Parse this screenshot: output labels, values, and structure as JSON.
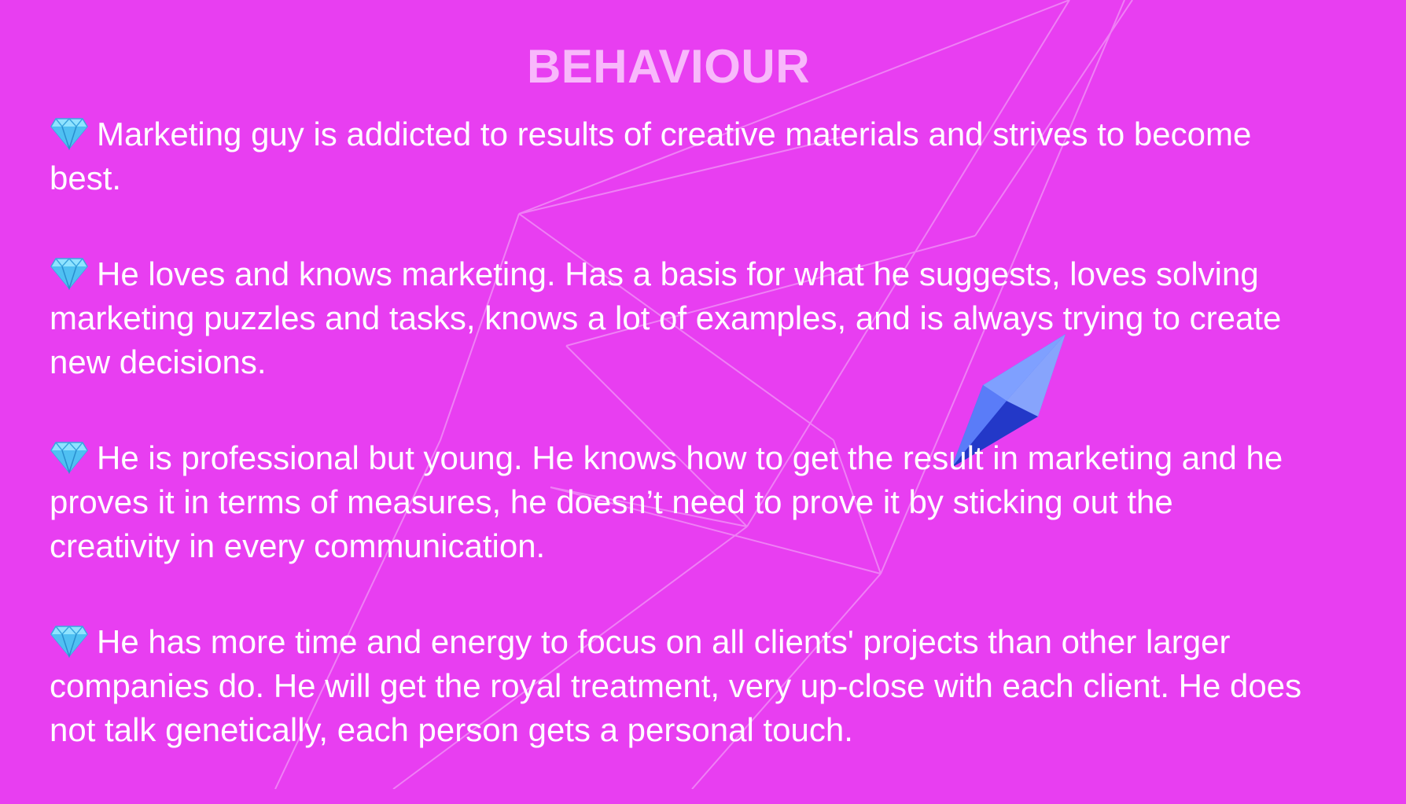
{
  "title": "BEHAVIOUR",
  "bullet_icon": "gem-stone-icon",
  "items": [
    {
      "text": "Marketing guy is addicted to results of creative materials and strives to become best."
    },
    {
      "text": "He loves and knows marketing. Has a basis for what he suggests, loves solving marketing puzzles and tasks, knows a lot of examples, and is always trying to create new decisions."
    },
    {
      "text": "He is professional but young. He knows how to get the result in marketing and he proves it in terms of measures, he doesn’t need to prove it by sticking out the creativity in every communication."
    },
    {
      "text": "He has more time and energy to focus on all clients' projects than other larger companies do. He will get the royal treatment, very up-close with each client. He does not talk genetically, each person gets a personal touch."
    }
  ],
  "colors": {
    "background": "#e83ef1",
    "title": "#f8b8fb",
    "text": "#ffffff",
    "crystal": "#3b5cf0"
  }
}
